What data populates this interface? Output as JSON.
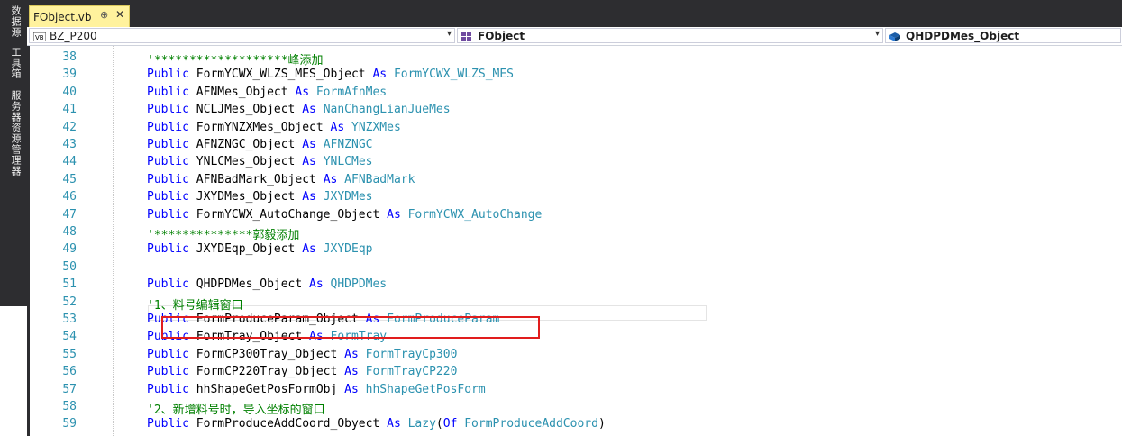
{
  "side_tabs": [
    "数据源",
    "工具箱",
    "服务器资源管理器"
  ],
  "document_tab": {
    "title": "FObject.vb",
    "pin_icon": "pin-icon",
    "close_icon": "close-icon"
  },
  "navbar": {
    "project": "BZ_P200",
    "class": "FObject",
    "member": "QHDPDMes_Object"
  },
  "lines": [
    {
      "n": "38",
      "tokens": [
        {
          "t": "'*******************峰添加",
          "c": "cm"
        }
      ]
    },
    {
      "n": "39",
      "tokens": [
        {
          "t": "Public ",
          "c": "kw"
        },
        {
          "t": "FormYCWX_WLZS_MES_Object ",
          "c": ""
        },
        {
          "t": "As ",
          "c": "kw"
        },
        {
          "t": "FormYCWX_WLZS_MES",
          "c": "ty"
        }
      ]
    },
    {
      "n": "40",
      "tokens": [
        {
          "t": "Public ",
          "c": "kw"
        },
        {
          "t": "AFNMes_Object ",
          "c": ""
        },
        {
          "t": "As ",
          "c": "kw"
        },
        {
          "t": "FormAfnMes",
          "c": "ty"
        }
      ]
    },
    {
      "n": "41",
      "tokens": [
        {
          "t": "Public ",
          "c": "kw"
        },
        {
          "t": "NCLJMes_Object ",
          "c": ""
        },
        {
          "t": "As ",
          "c": "kw"
        },
        {
          "t": "NanChangLianJueMes",
          "c": "ty"
        }
      ]
    },
    {
      "n": "42",
      "tokens": [
        {
          "t": "Public ",
          "c": "kw"
        },
        {
          "t": "FormYNZXMes_Object ",
          "c": ""
        },
        {
          "t": "As ",
          "c": "kw"
        },
        {
          "t": "YNZXMes",
          "c": "ty"
        }
      ]
    },
    {
      "n": "43",
      "tokens": [
        {
          "t": "Public ",
          "c": "kw"
        },
        {
          "t": "AFNZNGC_Object ",
          "c": ""
        },
        {
          "t": "As ",
          "c": "kw"
        },
        {
          "t": "AFNZNGC",
          "c": "ty"
        }
      ]
    },
    {
      "n": "44",
      "tokens": [
        {
          "t": "Public ",
          "c": "kw"
        },
        {
          "t": "YNLCMes_Object ",
          "c": ""
        },
        {
          "t": "As ",
          "c": "kw"
        },
        {
          "t": "YNLCMes",
          "c": "ty"
        }
      ]
    },
    {
      "n": "45",
      "tokens": [
        {
          "t": "Public ",
          "c": "kw"
        },
        {
          "t": "AFNBadMark_Object ",
          "c": ""
        },
        {
          "t": "As ",
          "c": "kw"
        },
        {
          "t": "AFNBadMark",
          "c": "ty"
        }
      ]
    },
    {
      "n": "46",
      "tokens": [
        {
          "t": "Public ",
          "c": "kw"
        },
        {
          "t": "JXYDMes_Object ",
          "c": ""
        },
        {
          "t": "As ",
          "c": "kw"
        },
        {
          "t": "JXYDMes",
          "c": "ty"
        }
      ]
    },
    {
      "n": "47",
      "tokens": [
        {
          "t": "Public ",
          "c": "kw"
        },
        {
          "t": "FormYCWX_AutoChange_Object ",
          "c": ""
        },
        {
          "t": "As ",
          "c": "kw"
        },
        {
          "t": "FormYCWX_AutoChange",
          "c": "ty"
        }
      ]
    },
    {
      "n": "48",
      "tokens": [
        {
          "t": "'**************郭毅添加",
          "c": "cm"
        }
      ]
    },
    {
      "n": "49",
      "tokens": [
        {
          "t": "Public ",
          "c": "kw"
        },
        {
          "t": "JXYDEqp_Object ",
          "c": ""
        },
        {
          "t": "As ",
          "c": "kw"
        },
        {
          "t": "JXYDEqp",
          "c": "ty"
        }
      ]
    },
    {
      "n": "50",
      "tokens": []
    },
    {
      "n": "51",
      "tokens": [
        {
          "t": "Public ",
          "c": "kw"
        },
        {
          "t": "QHDPDMes_Object ",
          "c": ""
        },
        {
          "t": "As ",
          "c": "kw"
        },
        {
          "t": "QHDPDMes",
          "c": "ty"
        }
      ]
    },
    {
      "n": "52",
      "tokens": [
        {
          "t": "'1、料号编辑窗口",
          "c": "cm"
        }
      ]
    },
    {
      "n": "53",
      "tokens": [
        {
          "t": "Public ",
          "c": "kw"
        },
        {
          "t": "FormProduceParam_Object ",
          "c": ""
        },
        {
          "t": "As ",
          "c": "kw"
        },
        {
          "t": "FormProduceParam",
          "c": "ty"
        }
      ]
    },
    {
      "n": "54",
      "tokens": [
        {
          "t": "Public ",
          "c": "kw"
        },
        {
          "t": "FormTray_Object ",
          "c": ""
        },
        {
          "t": "As ",
          "c": "kw"
        },
        {
          "t": "FormTray",
          "c": "ty"
        }
      ]
    },
    {
      "n": "55",
      "tokens": [
        {
          "t": "Public ",
          "c": "kw"
        },
        {
          "t": "FormCP300Tray_Object ",
          "c": ""
        },
        {
          "t": "As ",
          "c": "kw"
        },
        {
          "t": "FormTrayCp300",
          "c": "ty"
        }
      ]
    },
    {
      "n": "56",
      "tokens": [
        {
          "t": "Public ",
          "c": "kw"
        },
        {
          "t": "FormCP220Tray_Object ",
          "c": ""
        },
        {
          "t": "As ",
          "c": "kw"
        },
        {
          "t": "FormTrayCP220",
          "c": "ty"
        }
      ]
    },
    {
      "n": "57",
      "tokens": [
        {
          "t": "Public ",
          "c": "kw"
        },
        {
          "t": "hhShapeGetPosFormObj ",
          "c": ""
        },
        {
          "t": "As ",
          "c": "kw"
        },
        {
          "t": "hhShapeGetPosForm",
          "c": "ty"
        }
      ]
    },
    {
      "n": "58",
      "tokens": [
        {
          "t": "'2、新增料号时，导入坐标的窗口",
          "c": "cm"
        }
      ]
    },
    {
      "n": "59",
      "tokens": [
        {
          "t": "Public ",
          "c": "kw"
        },
        {
          "t": "FormProduceAddCoord_Obyect ",
          "c": ""
        },
        {
          "t": "As ",
          "c": "kw"
        },
        {
          "t": "Lazy",
          "c": "ty"
        },
        {
          "t": "(",
          "c": ""
        },
        {
          "t": "Of ",
          "c": "kw"
        },
        {
          "t": "FormProduceAddCoord",
          "c": "ty"
        },
        {
          "t": ")",
          "c": ""
        }
      ]
    }
  ]
}
